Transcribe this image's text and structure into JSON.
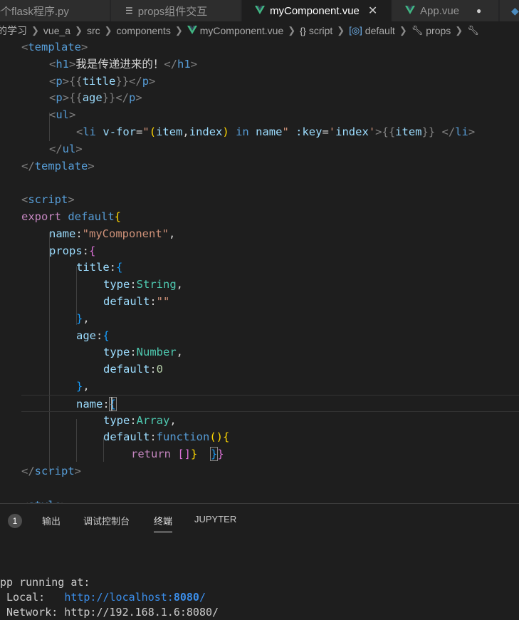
{
  "tabs": [
    {
      "label": "一个flask程序.py",
      "icon": "python-icon"
    },
    {
      "label": "props组件交互",
      "icon": "lines-icon"
    },
    {
      "label": "myComponent.vue",
      "icon": "vue-icon",
      "active": true
    },
    {
      "label": "App.vue",
      "icon": "vue-icon",
      "modified": true
    }
  ],
  "breadcrumb": [
    "的学习",
    "vue_a",
    "src",
    "components",
    "myComponent.vue",
    "script",
    "default",
    "props"
  ],
  "code_lines": [
    [
      [
        "t-punct",
        "<"
      ],
      [
        "t-tag",
        "template"
      ],
      [
        "t-punct",
        ">"
      ]
    ],
    [
      [
        "t-punct",
        "<"
      ],
      [
        "t-tag",
        "h1"
      ],
      [
        "t-punct",
        ">"
      ],
      [
        "t-text",
        "我是传递进来的！"
      ],
      [
        "t-punct",
        "</"
      ],
      [
        "t-tag",
        "h1"
      ],
      [
        "t-punct",
        ">"
      ]
    ],
    [
      [
        "t-punct",
        "<"
      ],
      [
        "t-tag",
        "p"
      ],
      [
        "t-punct",
        ">{{"
      ],
      [
        "t-attr",
        "title"
      ],
      [
        "t-punct",
        "}}</"
      ],
      [
        "t-tag",
        "p"
      ],
      [
        "t-punct",
        ">"
      ]
    ],
    [
      [
        "t-punct",
        "<"
      ],
      [
        "t-tag",
        "p"
      ],
      [
        "t-punct",
        ">{{"
      ],
      [
        "t-attr",
        "age"
      ],
      [
        "t-punct",
        "}}</"
      ],
      [
        "t-tag",
        "p"
      ],
      [
        "t-punct",
        ">"
      ]
    ],
    [
      [
        "t-punct",
        "<"
      ],
      [
        "t-tag",
        "ul"
      ],
      [
        "t-punct",
        ">"
      ]
    ],
    [
      [
        "t-punct",
        "<"
      ],
      [
        "t-tag",
        "li"
      ],
      [
        "t-text",
        " "
      ],
      [
        "t-attr",
        "v-for"
      ],
      [
        "t-text",
        "="
      ],
      [
        "t-str",
        "\""
      ],
      [
        "t-b1",
        "("
      ],
      [
        "t-attr",
        "item"
      ],
      [
        "t-text",
        ","
      ],
      [
        "t-attr",
        "index"
      ],
      [
        "t-b1",
        ")"
      ],
      [
        "t-text",
        " "
      ],
      [
        "t-kw",
        "in"
      ],
      [
        "t-text",
        " "
      ],
      [
        "t-attr",
        "name"
      ],
      [
        "t-str",
        "\""
      ],
      [
        "t-text",
        " "
      ],
      [
        "t-attr",
        ":key"
      ],
      [
        "t-text",
        "="
      ],
      [
        "t-str",
        "'"
      ],
      [
        "t-attr",
        "index"
      ],
      [
        "t-str",
        "'"
      ],
      [
        "t-punct",
        ">{{"
      ],
      [
        "t-attr",
        "item"
      ],
      [
        "t-punct",
        "}}"
      ],
      [
        "t-text",
        " "
      ],
      [
        "t-punct",
        "</"
      ],
      [
        "t-tag",
        "li"
      ],
      [
        "t-punct",
        ">"
      ]
    ],
    [
      [
        "t-punct",
        "</"
      ],
      [
        "t-tag",
        "ul"
      ],
      [
        "t-punct",
        ">"
      ]
    ],
    [
      [
        "t-punct",
        "</"
      ],
      [
        "t-tag",
        "template"
      ],
      [
        "t-punct",
        ">"
      ]
    ],
    [],
    [
      [
        "t-punct",
        "<"
      ],
      [
        "t-tag",
        "script"
      ],
      [
        "t-punct",
        ">"
      ]
    ],
    [
      [
        "t-ctrl",
        "export"
      ],
      [
        "t-text",
        " "
      ],
      [
        "t-kw",
        "default"
      ],
      [
        "t-b1",
        "{"
      ]
    ],
    [
      [
        "t-key",
        "name"
      ],
      [
        "t-text",
        ":"
      ],
      [
        "t-str",
        "\"myComponent\""
      ],
      [
        "t-text",
        ","
      ]
    ],
    [
      [
        "t-key",
        "props"
      ],
      [
        "t-text",
        ":"
      ],
      [
        "t-b2",
        "{"
      ]
    ],
    [
      [
        "t-key",
        "title"
      ],
      [
        "t-text",
        ":"
      ],
      [
        "t-b3",
        "{"
      ]
    ],
    [
      [
        "t-key",
        "type"
      ],
      [
        "t-text",
        ":"
      ],
      [
        "t-type",
        "String"
      ],
      [
        "t-text",
        ","
      ]
    ],
    [
      [
        "t-key",
        "default"
      ],
      [
        "t-text",
        ":"
      ],
      [
        "t-str",
        "\"\""
      ]
    ],
    [
      [
        "t-b3",
        "}"
      ],
      [
        "t-text",
        ","
      ]
    ],
    [
      [
        "t-key",
        "age"
      ],
      [
        "t-text",
        ":"
      ],
      [
        "t-b3",
        "{"
      ]
    ],
    [
      [
        "t-key",
        "type"
      ],
      [
        "t-text",
        ":"
      ],
      [
        "t-type",
        "Number"
      ],
      [
        "t-text",
        ","
      ]
    ],
    [
      [
        "t-key",
        "default"
      ],
      [
        "t-text",
        ":"
      ],
      [
        "t-num",
        "0"
      ]
    ],
    [
      [
        "t-b3",
        "}"
      ],
      [
        "t-text",
        ","
      ]
    ],
    [
      [
        "t-key",
        "name"
      ],
      [
        "t-text",
        ":"
      ],
      [
        "t-b3 boxed",
        "{"
      ]
    ],
    [
      [
        "t-key",
        "type"
      ],
      [
        "t-text",
        ":"
      ],
      [
        "t-type",
        "Array"
      ],
      [
        "t-text",
        ","
      ]
    ],
    [
      [
        "t-key",
        "default"
      ],
      [
        "t-text",
        ":"
      ],
      [
        "t-kw",
        "function"
      ],
      [
        "t-b1",
        "()"
      ],
      [
        "t-b1",
        "{"
      ]
    ],
    [
      [
        "t-ctrl",
        "return"
      ],
      [
        "t-text",
        " "
      ],
      [
        "t-b2",
        "[]"
      ],
      [
        "t-b1",
        "}"
      ],
      [
        "t-text",
        "  "
      ],
      [
        "t-b3 boxed",
        "}"
      ],
      [
        "t-b2",
        "}"
      ]
    ],
    [
      [
        "t-punct",
        "</"
      ],
      [
        "t-tag",
        "script"
      ],
      [
        "t-punct",
        ">"
      ]
    ],
    [],
    [
      [
        "t-punct",
        "<"
      ],
      [
        "t-tag",
        "style"
      ],
      [
        "t-punct",
        ">"
      ]
    ]
  ],
  "panel": {
    "badge": "1",
    "tabs": [
      "输出",
      "调试控制台",
      "终端",
      "JUPYTER"
    ],
    "active_tab": "终端",
    "terminal_line1": "pp running at:",
    "terminal_line2_label": " Local:   ",
    "terminal_url_prefix": "http://localhost:",
    "terminal_url_port": "8080",
    "terminal_url_suffix": "/",
    "terminal_line3": " Network: http://192.168.1.6:8080/"
  }
}
